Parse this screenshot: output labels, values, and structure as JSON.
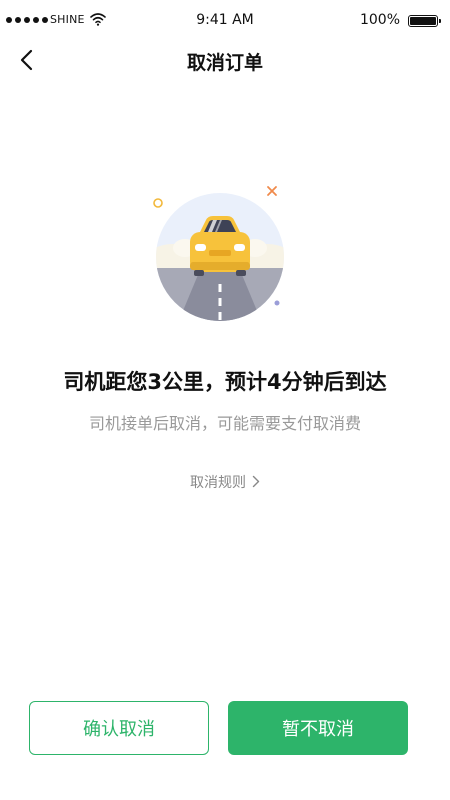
{
  "status_bar": {
    "carrier": "SHINE",
    "time": "9:41 AM",
    "battery": "100%"
  },
  "header": {
    "title": "取消订单"
  },
  "main": {
    "headline": "司机距您3公里，预计4分钟后到达",
    "subtext": "司机接单后取消，可能需要支付取消费",
    "rules_link": "取消规则"
  },
  "actions": {
    "confirm_cancel": "确认取消",
    "keep_order": "暂不取消"
  },
  "colors": {
    "accent": "#2db46a",
    "car": "#f7c23b"
  },
  "icons": [
    "signal-dots-icon",
    "wifi-icon",
    "battery-icon",
    "back-chevron-icon",
    "car-illustration",
    "chevron-right-icon"
  ]
}
